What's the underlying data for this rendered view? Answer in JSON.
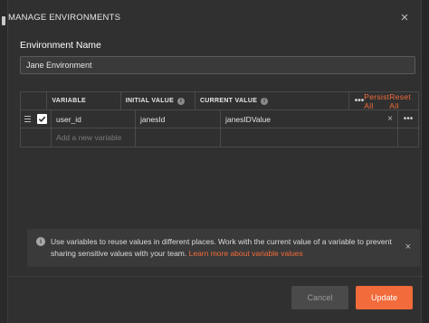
{
  "modal": {
    "title": "MANAGE ENVIRONMENTS",
    "close_glyph": "×"
  },
  "environment": {
    "label": "Environment Name",
    "name_value": "Jane Environment"
  },
  "table": {
    "headers": {
      "variable": "VARIABLE",
      "initial_value": "INITIAL VALUE",
      "current_value": "CURRENT VALUE",
      "more": "•••",
      "persist_all": "Persist All",
      "reset_all": "Reset All"
    },
    "rows": [
      {
        "checked": true,
        "variable": "user_id",
        "initial_value": "janesId",
        "current_value": "janesIDValue",
        "clear_glyph": "×",
        "more": "•••"
      }
    ],
    "new_row_placeholder": "Add a new variable"
  },
  "notice": {
    "text": "Use variables to reuse values in different places. Work with the current value of a variable to prevent sharing sensitive values with your team.",
    "link": "Learn more about variable values",
    "close_glyph": "×"
  },
  "footer": {
    "cancel_label": "Cancel",
    "update_label": "Update"
  },
  "colors": {
    "accent": "#f26b3a",
    "modal_bg": "#303030"
  }
}
